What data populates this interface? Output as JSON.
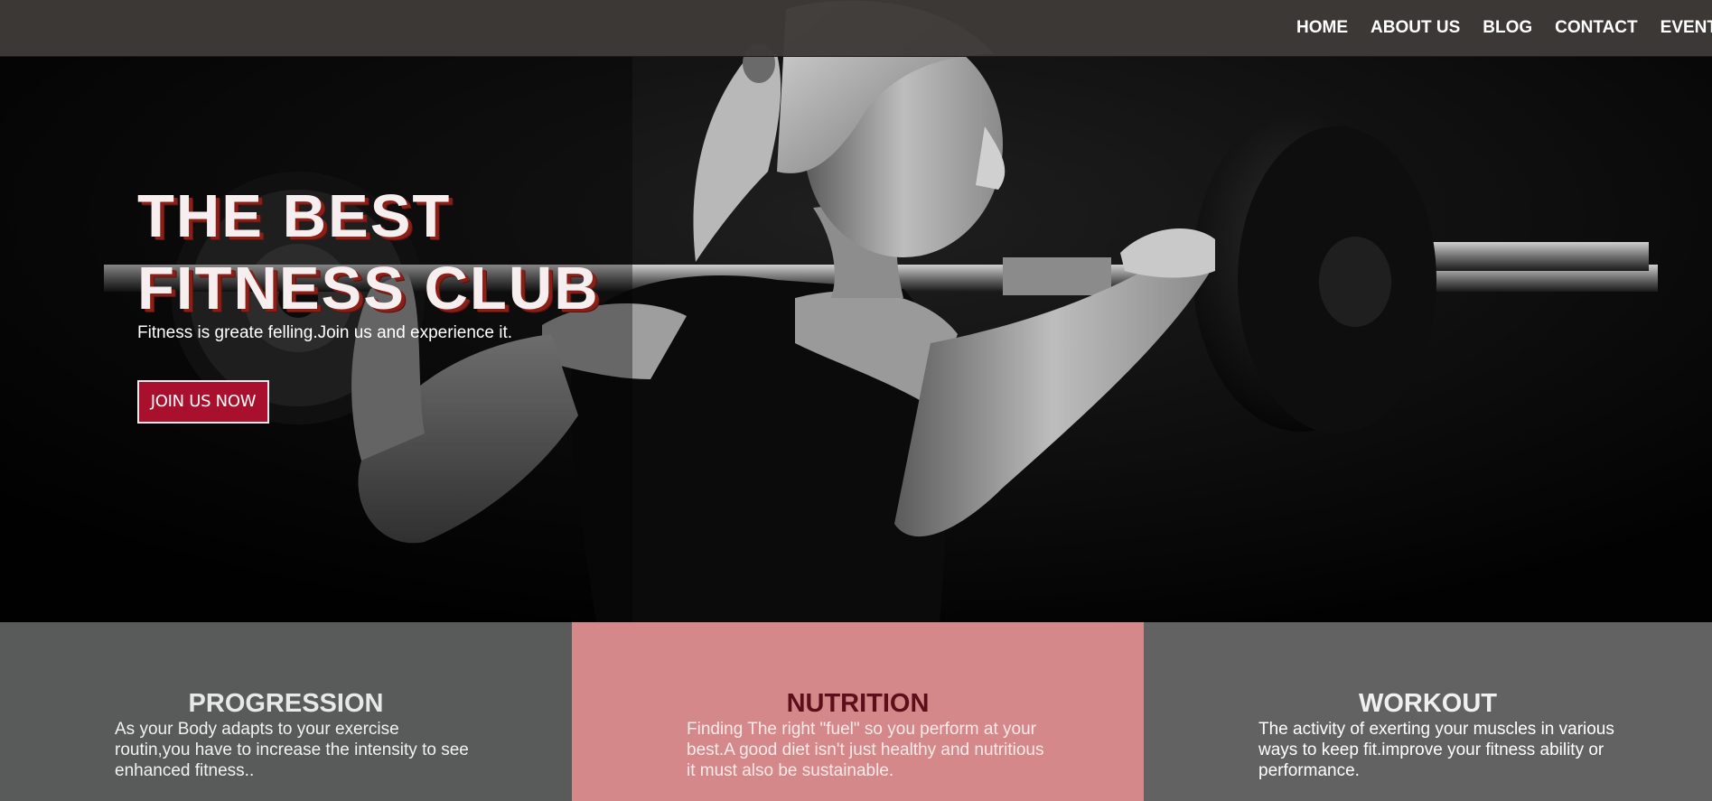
{
  "nav": {
    "items": [
      {
        "label": "HOME"
      },
      {
        "label": "ABOUT US"
      },
      {
        "label": "BLOG"
      },
      {
        "label": "CONTACT"
      },
      {
        "label": "EVENT"
      }
    ]
  },
  "hero": {
    "title_line1": "THE BEST",
    "title_line2": "FITNESS CLUB",
    "subtitle": "Fitness is greate felling.Join us and experience it.",
    "cta_label": "JOIN US NOW",
    "image_subject": "woman-lifting-barbell"
  },
  "features": [
    {
      "title": "PROGRESSION",
      "text": "As your Body adapts to your exercise routin,you have to increase the intensity to see enhanced fitness..",
      "bg_color": "#595a5a",
      "title_color": "#e8e8e8",
      "text_color": "#f2f2f2"
    },
    {
      "title": "NUTRITION",
      "text": "Finding The right \"fuel\" so you perform at your best.A good diet isn't just healthy and nutritious it must also be sustainable.",
      "bg_color": "#d5888a",
      "title_color": "#5c0f1a",
      "text_color": "#fbeaea"
    },
    {
      "title": "WORKOUT",
      "text": "The activity of exerting your muscles in various ways to keep fit.improve your fitness ability or performance.",
      "bg_color": "#626262",
      "title_color": "#f0f0f0",
      "text_color": "#ffffff"
    }
  ],
  "colors": {
    "topbar": "#3e3a37",
    "accent": "#a8102e",
    "title_shadow": "#8a1f17"
  }
}
